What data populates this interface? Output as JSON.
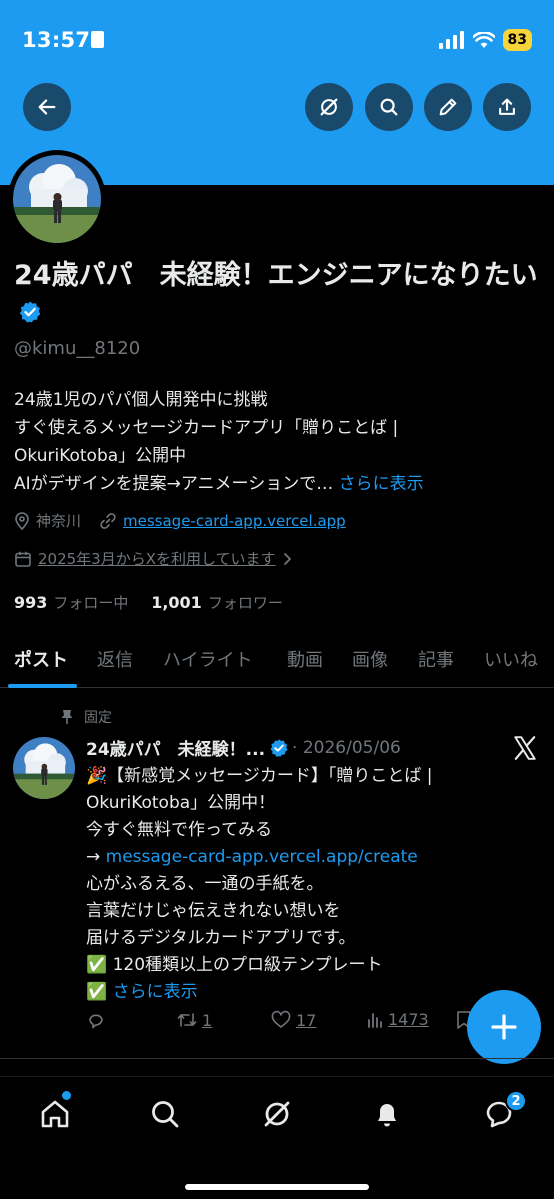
{
  "status_bar": {
    "time": "13:57",
    "battery": "83"
  },
  "profile": {
    "name": "24歳パパ　未経験！エンジニアになりたい",
    "handle": "@kimu__8120",
    "bio_lines": [
      "24歳1児のパパ個人開発中に挑戦",
      "すぐ使えるメッセージカードアプリ「贈りことば |",
      "OkuriKotoba」公開中",
      "AIがデザインを提案→アニメーションで…"
    ],
    "bio_more": "さらに表示",
    "location": "神奈川",
    "website": "message-card-app.vercel.app",
    "joined": "2025年3月からXを利用しています",
    "following_count": "993",
    "following_label": "フォロー中",
    "followers_count": "1,001",
    "followers_label": "フォロワー"
  },
  "tabs": [
    "ポスト",
    "返信",
    "ハイライト",
    "動画",
    "画像",
    "記事",
    "いいね"
  ],
  "pinned_post": {
    "pinned_label": "固定",
    "author": "24歳パパ　未経験！...",
    "date": "· 2026/05/06",
    "lines": [
      "🎉【新感覚メッセージカード】「贈りことば |",
      "OkuriKotoba」公開中！",
      "今すぐ無料で作ってみる"
    ],
    "link_prefix": "→ ",
    "link": "message-card-app.vercel.app/create",
    "lines2": [
      "心がふるえる、一通の手紙を。",
      "言葉だけじゃ伝えきれない想いを",
      "届けるデジタルカードアプリです。",
      "✅ 120種類以上のプロ級テンプレート"
    ],
    "check": "✅",
    "more": "さらに表示",
    "reposts": "1",
    "likes": "17",
    "views": "1473"
  },
  "notifications_badge": "2",
  "colors": {
    "accent": "#1d9bf0",
    "banner": "#1d9bf0",
    "background": "#000000",
    "muted": "#71767b"
  }
}
